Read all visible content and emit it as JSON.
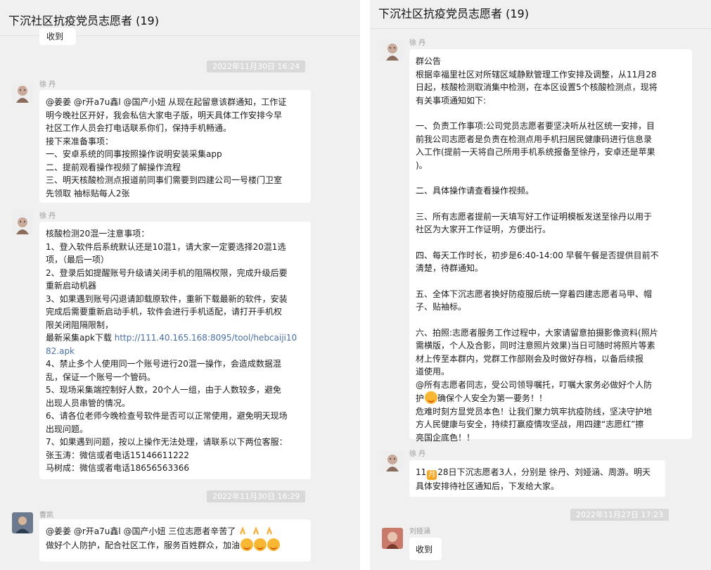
{
  "chat_title": "下沉社区抗疫党员志愿者 (19)",
  "left": {
    "top_snippet": "收到",
    "timestamps": [
      "2022年11月30日 16:24",
      "2022年11月30日 16:29"
    ],
    "messages": [
      {
        "sender": "徐 丹",
        "lines": [
          "@姜姜 @r开a7u鑫l @国产小妞  从现在起留意该群通知，工作证",
          "明今晚社区开好，我会私信大家电子版，明天具体工作安排今早",
          "社区工作人员会打电话联系你们，保持手机畅通。",
          "接下来准备事项：",
          "一、安卓系统的同事按照操作说明安装采集app",
          "二、提前观看操作视频了解操作流程",
          "三、明天核酸检测点报道前同事们需要到四建公司一号楼门卫室",
          "先领取 袖标贴每人2张"
        ]
      },
      {
        "sender": "徐 丹",
        "lines_before_link": [
          "核酸检测20混一注意事项：",
          "1、登入软件后系统默认还是10混1，请大家一定要选择20混1选",
          "项，（最后一项）",
          "2、登录后如提醒账号升级请关闭手机的阻隔权限，完成升级后要",
          "重新启动机器",
          "3、如果遇到账号闪退请卸载原软件，重新下载最新的软件，安装",
          "完成后需要重新启动手机，软件会进行手机适配，请打开手机权",
          "限关闭阻隔限制，"
        ],
        "link_prefix": "最新采集apk下载 ",
        "link_line1": "http://111.40.165.168:8095/tool/hebcaiji10",
        "link_line2": "82.apk",
        "lines_after_link": [
          "4、禁止多个人使用同一个账号进行20混一操作，会造成数据混",
          "乱，保证一个账号一个管码。",
          "5、现场采集端控制好人数，20个人一组，由于人数较多，避免",
          "出现人员串管的情况。",
          "6、请各位老师今晚检查号软件是否可以正常使用，避免明天现场",
          "出现问题。",
          "7、如果遇到问题，按以上操作无法处理，请联系以下两位客服：",
          "张玉涛：微信或者电话15146611222",
          "马树成：微信或者电话18656563366"
        ]
      },
      {
        "sender": "曹凯",
        "line1": "@姜姜 @r开a7u鑫l @国产小妞  三位志愿者辛苦了",
        "line2": "做好个人防护，配合社区工作，服务百姓群众，加油"
      }
    ]
  },
  "right": {
    "timestamp": "2022年11月27日 17:23",
    "messages": [
      {
        "sender": "徐 丹",
        "paragraphs": [
          [
            "群公告",
            "根据幸福里社区对所辖区域静默管理工作安排及调整，从11月28",
            "日起，核酸检测取消集中检测，在本区设置5个核酸检测点，现将",
            "有关事项通知如下:"
          ],
          [
            "一、负责工作事项:公司党员志愿者要坚决听从社区统一安排，目",
            "前我公司志愿者是负责在检测点用手机扫居民健康码进行信息录",
            "入工作(提前一天将自己所用手机系统报备至徐丹，安卓还是苹果",
            ")。"
          ],
          [
            "二、具体操作请查看操作视频。"
          ],
          [
            "三、所有志愿者提前一天填写好工作证明模板发送至徐丹以用于",
            "社区为大家开工作证明，方便出行。"
          ],
          [
            "四、每天工作时长，初步是6:40-14:00 早餐午餐是否提供目前不",
            "清楚，待群通知。"
          ],
          [
            "五、全体下沉志愿者换好防疫服后统一穿着四建志愿者马甲、帽",
            "子、贴袖标。"
          ],
          [
            "六、拍照:志愿者服务工作过程中，大家请留意拍摄影像资料(照片",
            "需横版，个人及合影，同时注意照片效果)当日可随时将照片等素",
            "材上传至本群内，党群工作部刚会及时做好存档，以备后续报",
            "道使用。",
            "@所有志愿者同志，受公司领导嘱托，叮嘱大家务必做好个人防"
          ]
        ],
        "line_emoji_prefix": "护",
        "line_emoji_suffix": "确保个人安全为第一要务！！",
        "closing_lines": [
          "危难时刻方显党员本色！让我们聚力筑牢抗疫防线，坚决守护地",
          "方人民健康与安全，持续打赢疫情攻坚战，用四建“志愿红”擦",
          "亮国企底色！！"
        ]
      },
      {
        "sender": "徐 丹",
        "line1_prefix": "11",
        "line1_suffix": "28日下沉志愿者3人，分别是 徐丹、刘娅涵、周游。明天",
        "line2": "具体安排待社区通知后，下发给大家。"
      },
      {
        "sender": "刘娅涵",
        "text": "收到"
      }
    ]
  }
}
